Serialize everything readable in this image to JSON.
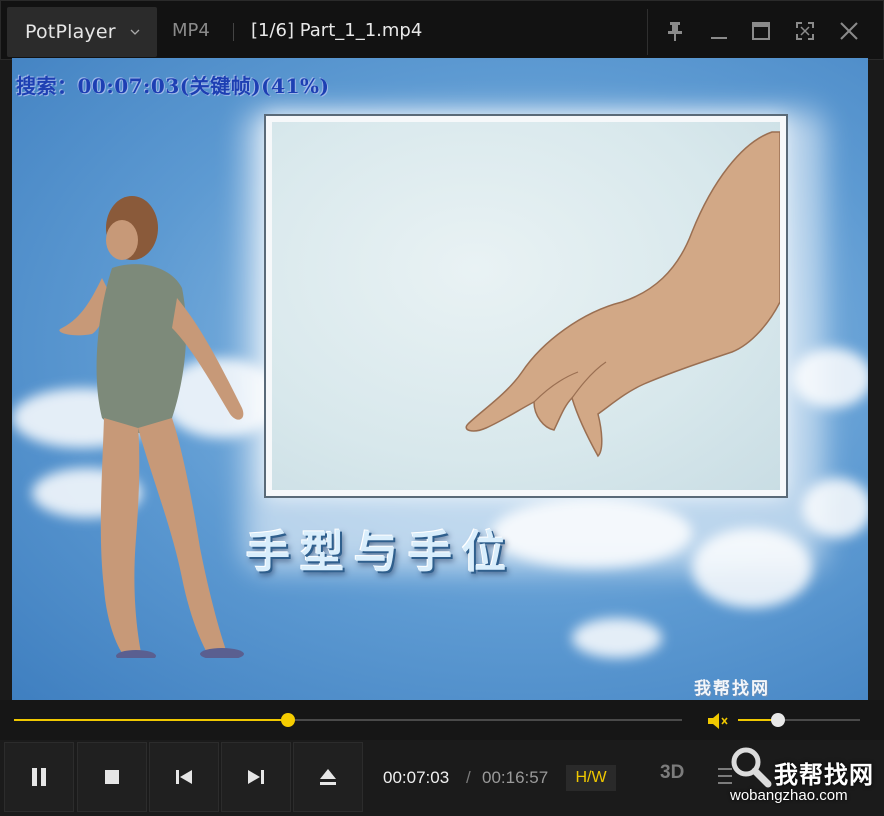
{
  "titlebar": {
    "app_name": "PotPlayer",
    "format": "MP4",
    "file_title": "[1/6] Part_1_1.mp4",
    "icons": [
      "chevron-down-icon",
      "pin-icon",
      "minimize-icon",
      "maximize-icon",
      "fullscreen-icon",
      "close-icon"
    ]
  },
  "video": {
    "osd_text": "搜索：00:07:03(关键帧)(41%)",
    "caption": "手型与手位",
    "corner_watermark": "我帮找网"
  },
  "seek": {
    "progress_percent": 41
  },
  "volume": {
    "level_percent": 33,
    "icons": [
      "speaker-icon"
    ]
  },
  "controls": {
    "buttons": [
      "pause-icon",
      "stop-icon",
      "previous-icon",
      "next-icon",
      "eject-icon"
    ],
    "time_current": "00:07:03",
    "time_separator": "/",
    "time_total": "00:16:57",
    "hw_label": "H/W",
    "three_d_label": "3D"
  },
  "site_watermark": {
    "name": "我帮找网",
    "url": "wobangzhao.com"
  },
  "colors": {
    "accent": "#f0c800",
    "background": "#1b1b1b",
    "osd_blue": "#1d3fb3"
  }
}
